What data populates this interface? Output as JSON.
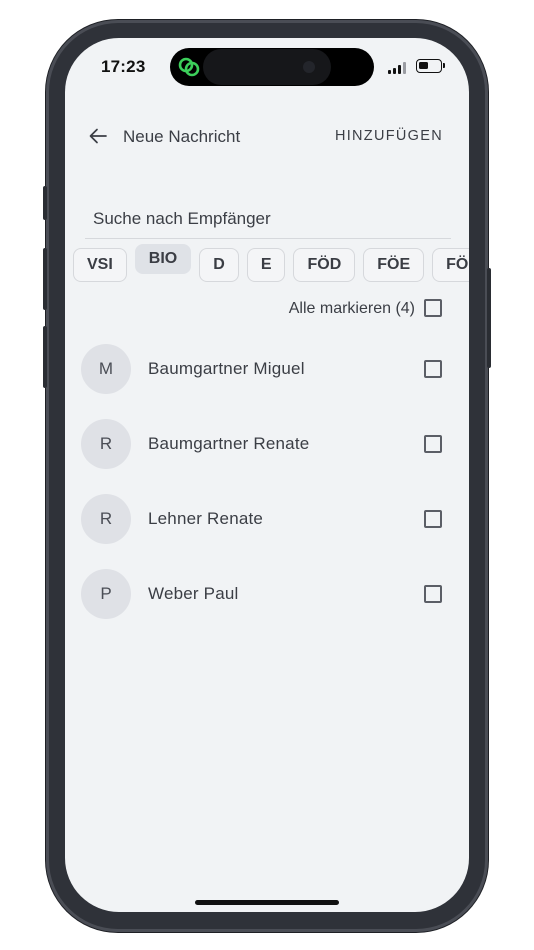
{
  "status_bar": {
    "time": "17:23",
    "battery_level": 0.45,
    "signal_bars": 3
  },
  "header": {
    "back_icon": "arrow-left-icon",
    "title": "Neue Nachricht",
    "action_label": "HINZUFÜGEN"
  },
  "search": {
    "placeholder": "Suche nach Empfänger",
    "value": ""
  },
  "filters": {
    "chips": [
      "VSI",
      "BIO",
      "D",
      "E",
      "FÖD",
      "FÖE",
      "FÖM"
    ],
    "selected": "BIO"
  },
  "mark_all": {
    "label": "Alle markieren (4)",
    "checked": false
  },
  "recipients": [
    {
      "initial": "M",
      "name": "Baumgartner Miguel",
      "checked": false
    },
    {
      "initial": "R",
      "name": "Baumgartner Renate",
      "checked": false
    },
    {
      "initial": "R",
      "name": "Lehner Renate",
      "checked": false
    },
    {
      "initial": "P",
      "name": "Weber Paul",
      "checked": false
    }
  ],
  "colors": {
    "background": "#f1f3f5",
    "text": "#3b3e45",
    "avatar": "#dfe1e6",
    "chip_active": "#dfe2e7",
    "frame": "#2f3239",
    "app_icon": "#3ccf5a"
  }
}
